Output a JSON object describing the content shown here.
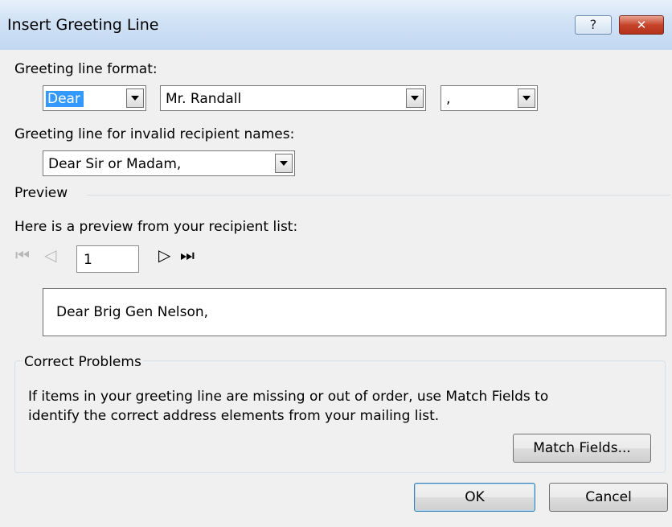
{
  "window": {
    "title": "Insert Greeting Line",
    "help_glyph": "?",
    "close_glyph": "✕"
  },
  "greeting_format": {
    "label": "Greeting line format:",
    "salutation": "Dear",
    "name_format": "Mr. Randall",
    "punctuation": ","
  },
  "invalid_names": {
    "label": "Greeting line for invalid recipient names:",
    "value": "Dear Sir or Madam,"
  },
  "preview": {
    "section_label": "Preview",
    "intro": "Here is a preview from your recipient list:",
    "record_number": "1",
    "text": "Dear Brig Gen Nelson,",
    "nav_first": "⏮",
    "nav_prev": "◁",
    "nav_next": "▷",
    "nav_last": "⏭"
  },
  "correct_problems": {
    "label": "Correct Problems",
    "line1": "If items in your greeting line are missing or out of order, use Match Fields to",
    "line2": "identify the correct address elements from your mailing list.",
    "match_fields_button": "Match Fields..."
  },
  "buttons": {
    "ok": "OK",
    "cancel": "Cancel"
  }
}
